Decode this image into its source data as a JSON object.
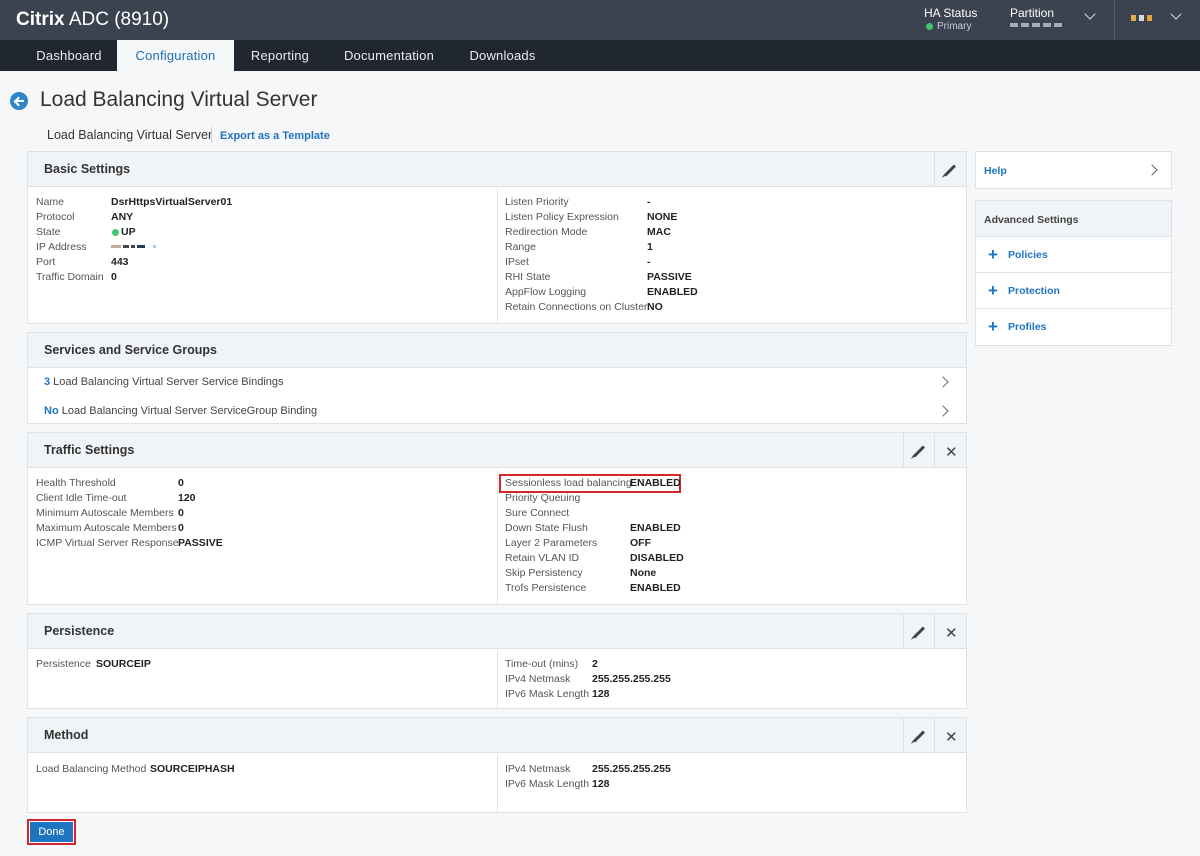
{
  "header": {
    "brand_bold": "Citrix",
    "brand_rest": "ADC (8910)",
    "ha_status_label": "HA Status",
    "ha_status_value": "Primary",
    "partition_label": "Partition",
    "ha_status_color": "#46c26a"
  },
  "nav": {
    "tabs": [
      {
        "label": "Dashboard"
      },
      {
        "label": "Configuration"
      },
      {
        "label": "Reporting"
      },
      {
        "label": "Documentation"
      },
      {
        "label": "Downloads"
      }
    ],
    "active": "Configuration"
  },
  "page": {
    "title": "Load Balancing Virtual Server",
    "breadcrumb": "Load Balancing Virtual Server",
    "export_link": "Export as a Template"
  },
  "basic": {
    "title": "Basic Settings",
    "left": [
      {
        "k": "Name",
        "v": "DsrHttpsVirtualServer01"
      },
      {
        "k": "Protocol",
        "v": "ANY"
      },
      {
        "k": "State",
        "v": "UP"
      },
      {
        "k": "IP Address",
        "v": ""
      },
      {
        "k": "Port",
        "v": "443"
      },
      {
        "k": "Traffic Domain",
        "v": "0"
      }
    ],
    "right": [
      {
        "k": "Listen Priority",
        "v": "-"
      },
      {
        "k": "Listen Policy Expression",
        "v": "NONE"
      },
      {
        "k": "Redirection Mode",
        "v": "MAC"
      },
      {
        "k": "Range",
        "v": "1"
      },
      {
        "k": "IPset",
        "v": "-"
      },
      {
        "k": "RHI State",
        "v": "PASSIVE"
      },
      {
        "k": "AppFlow Logging",
        "v": "ENABLED"
      },
      {
        "k": "Retain Connections on Cluster",
        "v": "NO"
      }
    ]
  },
  "services": {
    "title": "Services and Service Groups",
    "rows": [
      {
        "count": "3",
        "text": " Load Balancing Virtual Server Service Bindings"
      },
      {
        "count": "No",
        "text": " Load Balancing Virtual Server ServiceGroup Binding"
      }
    ]
  },
  "traffic": {
    "title": "Traffic Settings",
    "left": [
      {
        "k": "Health Threshold",
        "v": "0"
      },
      {
        "k": "Client Idle Time-out",
        "v": "120"
      },
      {
        "k": "Minimum Autoscale Members",
        "v": "0"
      },
      {
        "k": "Maximum Autoscale Members",
        "v": "0"
      },
      {
        "k": "ICMP Virtual Server Response",
        "v": "PASSIVE"
      }
    ],
    "right": [
      {
        "k": "Sessionless load balancing",
        "v": "ENABLED"
      },
      {
        "k": "Priority Queuing",
        "v": ""
      },
      {
        "k": "Sure Connect",
        "v": ""
      },
      {
        "k": "Down State Flush",
        "v": "ENABLED"
      },
      {
        "k": "Layer 2 Parameters",
        "v": "OFF"
      },
      {
        "k": "Retain VLAN ID",
        "v": "DISABLED"
      },
      {
        "k": "Skip Persistency",
        "v": "None"
      },
      {
        "k": "Trofs Persistence",
        "v": "ENABLED"
      }
    ]
  },
  "persistence": {
    "title": "Persistence",
    "left": [
      {
        "k": "Persistence",
        "v": "SOURCEIP"
      }
    ],
    "right": [
      {
        "k": "Time-out (mins)",
        "v": "2"
      },
      {
        "k": "IPv4 Netmask",
        "v": "255.255.255.255"
      },
      {
        "k": "IPv6 Mask Length",
        "v": "128"
      }
    ]
  },
  "method": {
    "title": "Method",
    "left": [
      {
        "k": "Load Balancing Method",
        "v": "SOURCEIPHASH"
      }
    ],
    "right": [
      {
        "k": "IPv4 Netmask",
        "v": "255.255.255.255"
      },
      {
        "k": "IPv6 Mask Length",
        "v": "128"
      }
    ]
  },
  "sidebar": {
    "help": "Help",
    "advanced_title": "Advanced Settings",
    "items": [
      {
        "label": "Policies"
      },
      {
        "label": "Protection"
      },
      {
        "label": "Profiles"
      }
    ]
  },
  "footer": {
    "done_label": "Done"
  },
  "colors": {
    "accent": "#1f74c0",
    "highlight": "#d6262b",
    "header_bg": "#3b4350",
    "nav_bg": "#20272f"
  }
}
